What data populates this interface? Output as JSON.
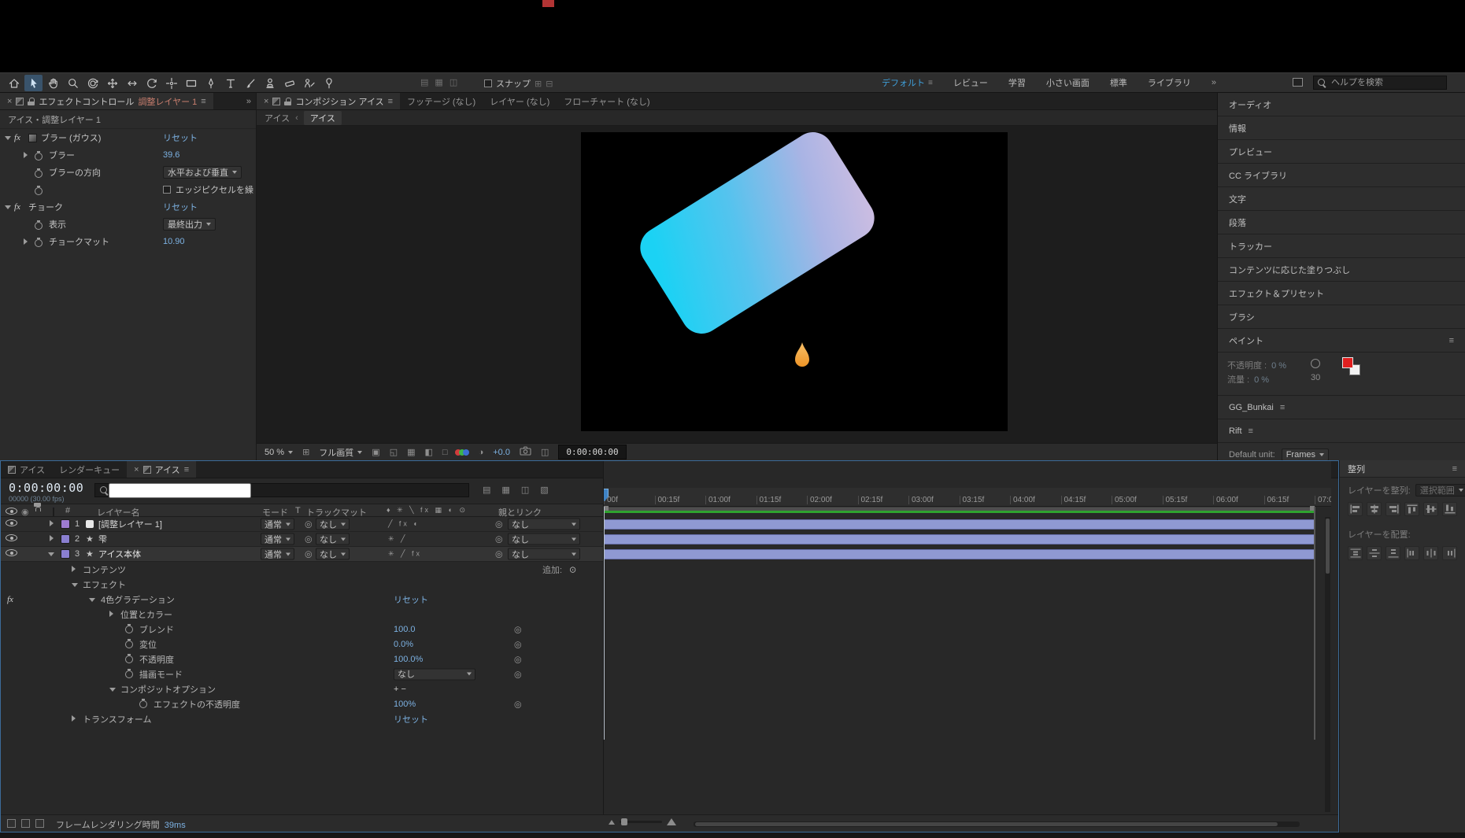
{
  "colors": {
    "accent_blue": "#3f83c4",
    "value_blue": "#7cb1e2",
    "workspace_active_blue": "#3f9fda",
    "render_bar_green": "#2fa32f",
    "layer_bar_purple": "#8f99d3",
    "label_chip_violet": "#8a7fd0",
    "paint_swatch_red": "#e01f1f",
    "title_marker_red": "#b23434",
    "card_gradient_start": "#1bd2f4",
    "card_gradient_end": "#ccbde2",
    "drip_orange": "#ee9426"
  },
  "toolbar": {
    "snap_label": "スナップ",
    "workspaces": [
      "デフォルト",
      "レビュー",
      "学習",
      "小さい画面",
      "標準",
      "ライブラリ"
    ],
    "overflow": "»",
    "search_placeholder": "ヘルプを検索"
  },
  "effect_controls": {
    "close": "×",
    "title": "エフェクトコントロール",
    "target_layer": "調整レイヤー 1",
    "menu": "≡",
    "overflow": "»",
    "source_line": "アイス・調整レイヤー 1",
    "effect1_name": "ブラー (ガウス)",
    "effect1_reset": "リセット",
    "blur_label": "ブラー",
    "blur_value": "39.6",
    "direction_label": "ブラーの方向",
    "direction_value": "水平および垂直",
    "edge_label": "エッジピクセルを繰",
    "effect2_name": "チョーク",
    "effect2_reset": "リセット",
    "view_label": "表示",
    "view_value": "最終出力",
    "matte_label": "チョークマット",
    "matte_value": "10.90"
  },
  "composition": {
    "close": "×",
    "tab_label": "コンポジション アイス",
    "menu": "≡",
    "tab_footage": "フッテージ (なし)",
    "tab_layer": "レイヤー (なし)",
    "tab_flowchart": "フローチャート (なし)",
    "crumb_prev": "アイス",
    "crumb_sep": "‹",
    "crumb_current": "アイス",
    "zoom_value": "50 %",
    "quality_value": "フル画質",
    "exposure_value": "+0.0",
    "timecode": "0:00:00:00"
  },
  "right_stack": {
    "panels": [
      "オーディオ",
      "情報",
      "プレビュー",
      "CC ライブラリ",
      "文字",
      "段落",
      "トラッカー",
      "コンテンツに応じた塗りつぶし",
      "エフェクト＆プリセット",
      "ブラシ"
    ],
    "paint_title": "ペイント",
    "paint_menu": "≡",
    "opacity_label": "不透明度 :",
    "opacity_value": "0 %",
    "flow_label": "流量 :",
    "flow_value": "0 %",
    "brush_size": "30",
    "gg_title": "GG_Bunkai",
    "rift_title": "Rift",
    "menu": "≡",
    "default_unit_label": "Default unit:",
    "default_unit_value": "Frames"
  },
  "timeline": {
    "tab1": "アイス",
    "tab2": "レンダーキュー",
    "tab3": "アイス",
    "close": "×",
    "menu": "≡",
    "timecode": "0:00:00:00",
    "frame_info": "00000 (30.00 fps)",
    "col_name": "レイヤー名",
    "col_mode": "モード",
    "col_t": "T",
    "col_matte": "トラックマット",
    "col_switches": "♦ ✳ ╲ fx ▦ ◐ ⊙",
    "col_parent": "親とリンク",
    "add_label": "追加:",
    "add_icon": "⊙",
    "layers": [
      {
        "index": "1",
        "name": "[調整レイヤー 1]",
        "mode": "通常",
        "matte": "なし",
        "parent": "なし",
        "switches": "╱ fx ◐"
      },
      {
        "index": "2",
        "name": "雫",
        "mode": "通常",
        "matte": "なし",
        "parent": "なし",
        "switches": "✳ ╱"
      },
      {
        "index": "3",
        "name": "アイス本体",
        "mode": "通常",
        "matte": "なし",
        "parent": "なし",
        "switches": "✳ ╱ fx"
      }
    ],
    "prop_contents": "コンテンツ",
    "prop_effects": "エフェクト",
    "prop_grad": "4色グラデーション",
    "prop_grad_reset": "リセット",
    "prop_poscolor": "位置とカラー",
    "prop_blend": "ブレンド",
    "prop_blend_value": "100.0",
    "prop_disp": "変位",
    "prop_disp_value": "0.0%",
    "prop_opacity": "不透明度",
    "prop_opacity_value": "100.0%",
    "prop_blendmode": "描画モード",
    "prop_blendmode_value": "なし",
    "prop_compopts": "コンポジットオプション",
    "prop_compopts_value": "+ −",
    "prop_fxopacity": "エフェクトの不透明度",
    "prop_fxopacity_value": "100%",
    "prop_transform": "トランスフォーム",
    "prop_transform_reset": "リセット",
    "ruler": [
      "00f",
      "00:15f",
      "01:00f",
      "01:15f",
      "02:00f",
      "02:15f",
      "03:00f",
      "03:15f",
      "04:00f",
      "04:15f",
      "05:00f",
      "05:15f",
      "06:00f",
      "06:15f",
      "07:0"
    ],
    "status_label": "フレームレンダリング時間",
    "status_value": "39ms"
  },
  "align_panel": {
    "title": "整列",
    "menu": "≡",
    "align_label": "レイヤーを整列:",
    "align_mode": "選択範囲",
    "distribute_label": "レイヤーを配置:"
  }
}
